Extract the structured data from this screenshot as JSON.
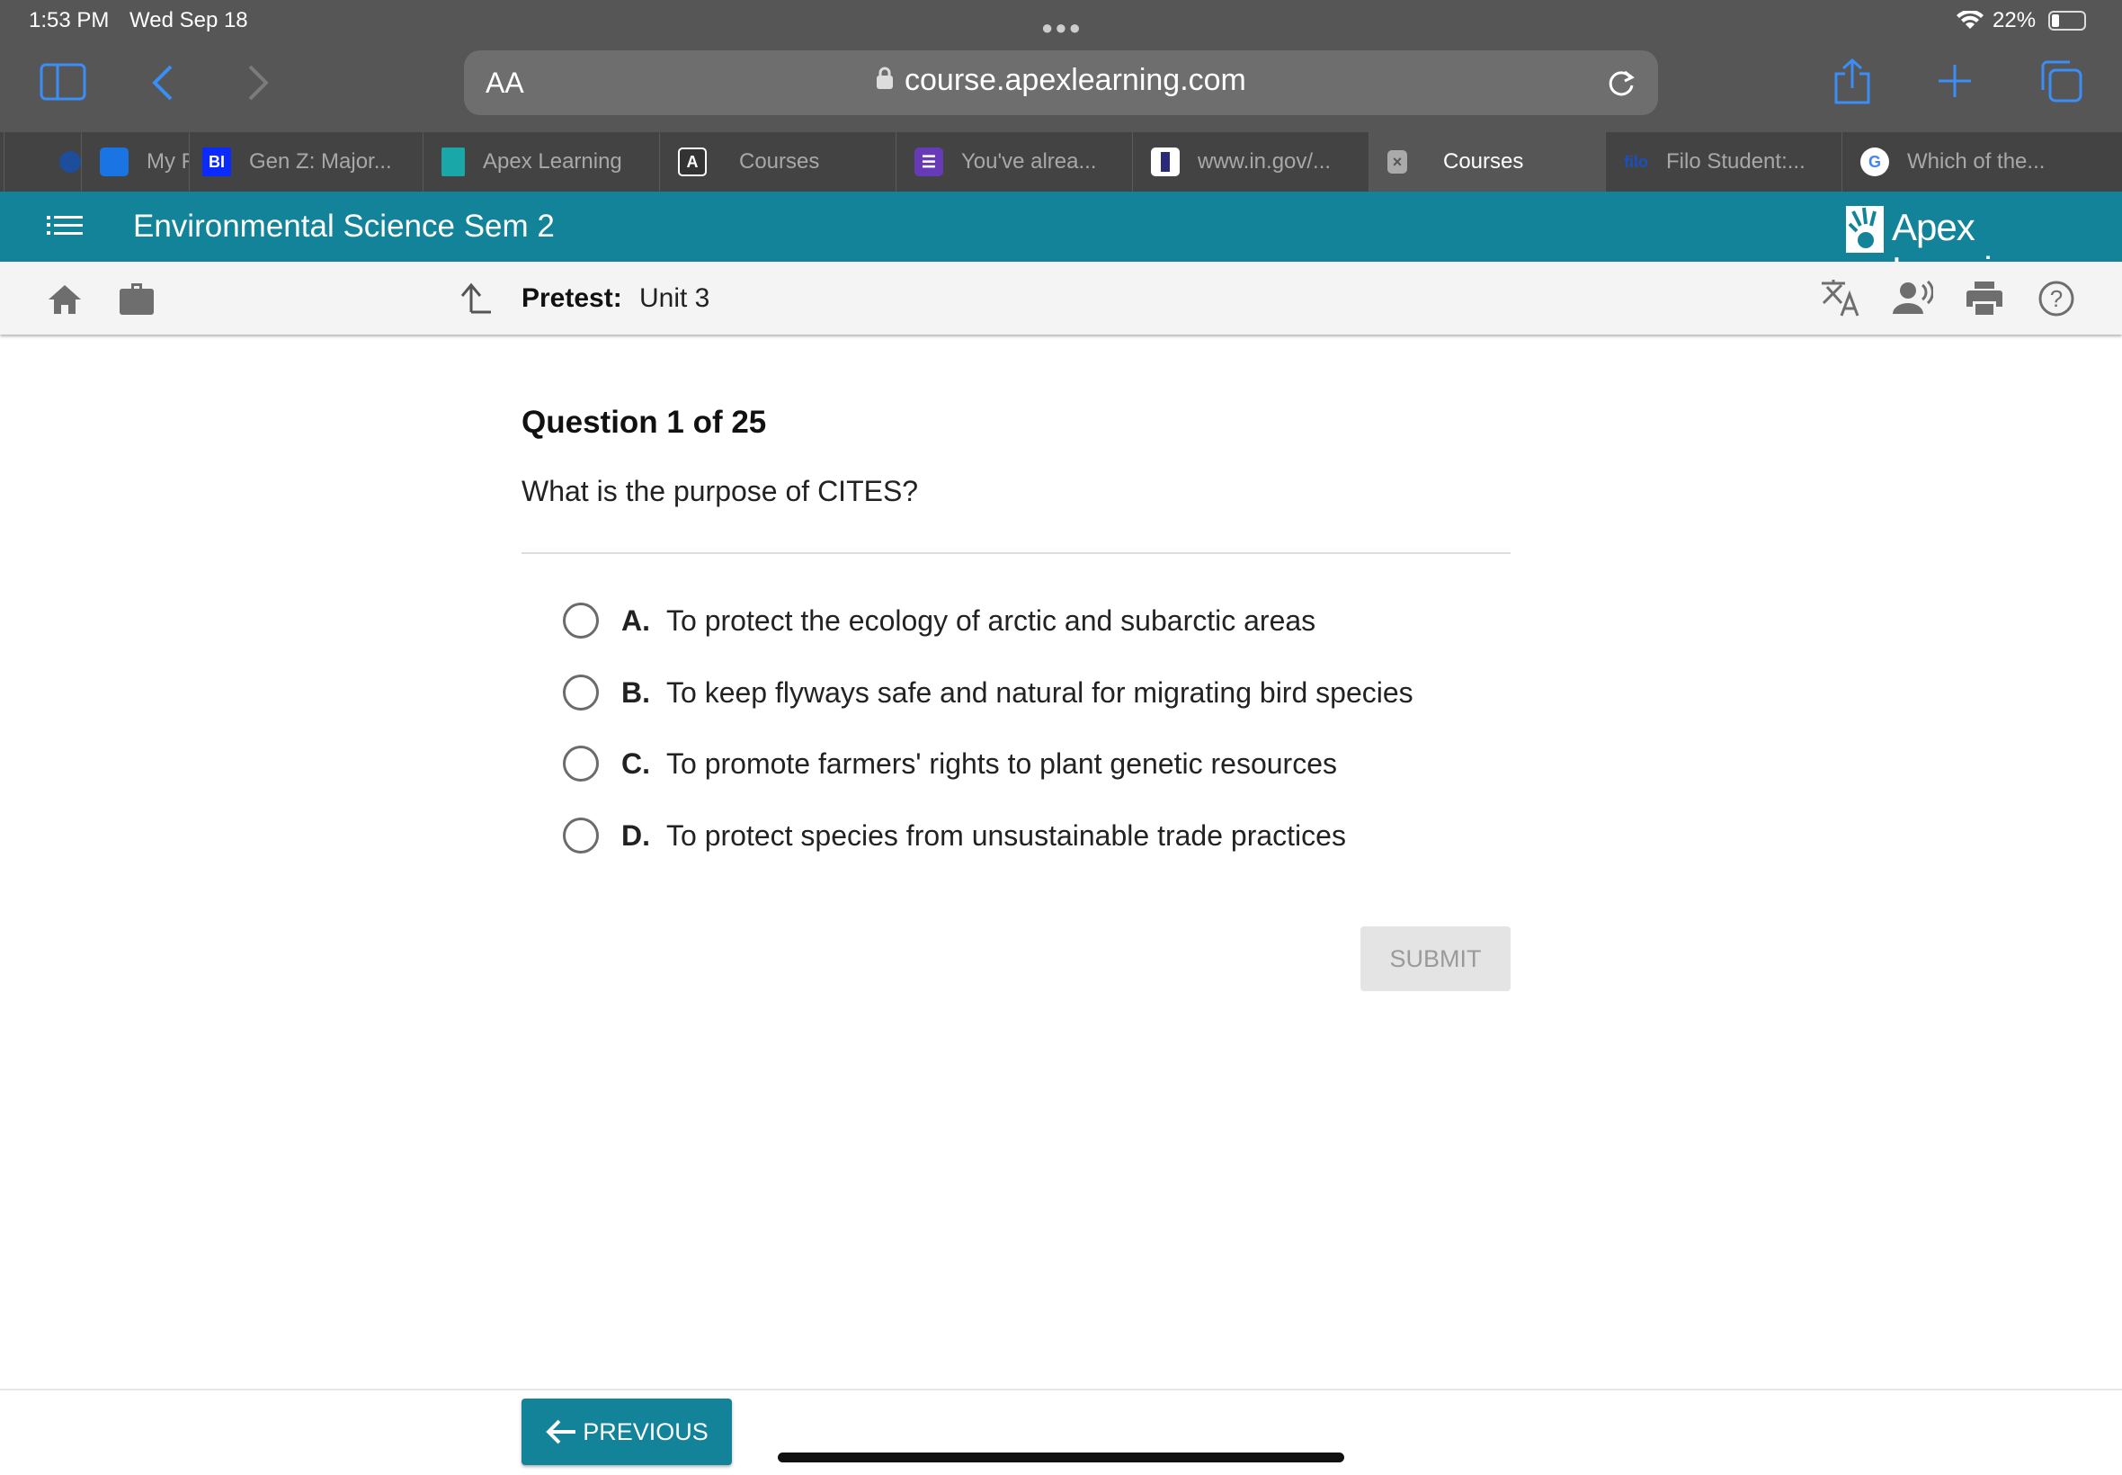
{
  "status": {
    "time": "1:53 PM",
    "date": "Wed Sep 18",
    "battery": "22%"
  },
  "browser": {
    "text_size": "AA",
    "url": "course.apexlearning.com"
  },
  "tabs": [
    {
      "label": "",
      "icon": "onet-icon"
    },
    {
      "label": "My Fa",
      "icon": "zillow-icon"
    },
    {
      "label": "Gen Z: Major...",
      "icon": "bi-icon",
      "fav": "BI"
    },
    {
      "label": "Apex Learning",
      "icon": "apex-icon"
    },
    {
      "label": "Courses",
      "icon": "a-icon",
      "fav": "A"
    },
    {
      "label": "You've alrea...",
      "icon": "forms-icon"
    },
    {
      "label": "www.in.gov/...",
      "icon": "indiana-icon"
    },
    {
      "label": "Courses",
      "icon": "close-icon",
      "active": true
    },
    {
      "label": "Filo Student:...",
      "icon": "filo-icon",
      "fav": "filo"
    },
    {
      "label": "Which of the...",
      "icon": "google-icon",
      "fav": "G"
    }
  ],
  "header": {
    "course_title": "Environmental Science Sem 2",
    "logo_text": "Apex Learning"
  },
  "toolbar": {
    "pretest_label": "Pretest:",
    "unit": "Unit 3"
  },
  "question": {
    "heading": "Question 1 of 25",
    "prompt": "What is the purpose of CITES?",
    "options": [
      {
        "letter": "A.",
        "text": "To protect the ecology of arctic and subarctic areas"
      },
      {
        "letter": "B.",
        "text": "To keep flyways safe and natural for migrating bird species"
      },
      {
        "letter": "C.",
        "text": "To promote farmers' rights to plant genetic resources"
      },
      {
        "letter": "D.",
        "text": "To protect species from unsustainable trade practices"
      }
    ],
    "submit_label": "SUBMIT"
  },
  "footer": {
    "previous_label": "PREVIOUS"
  },
  "colors": {
    "teal": "#13839a",
    "chrome": "#565656",
    "tabbar": "#434343",
    "accent": "#3a8ef6"
  }
}
